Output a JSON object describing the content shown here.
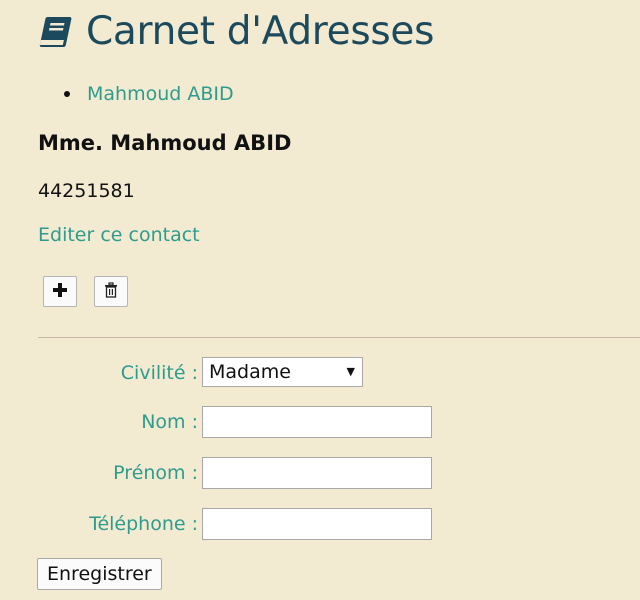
{
  "header": {
    "title": "Carnet d'Adresses",
    "icon": "book-icon"
  },
  "contacts": [
    {
      "label": "Mahmoud ABID"
    }
  ],
  "selected_contact": {
    "full_name": "Mme. Mahmoud ABID",
    "phone": "44251581",
    "edit_link": "Editer ce contact"
  },
  "actions": {
    "add_icon": "plus-icon",
    "delete_icon": "trash-icon"
  },
  "form": {
    "civilite": {
      "label": "Civilité :",
      "value": "Madame"
    },
    "nom": {
      "label": "Nom :",
      "value": ""
    },
    "prenom": {
      "label": "Prénom :",
      "value": ""
    },
    "telephone": {
      "label": "Téléphone :",
      "value": ""
    },
    "submit_label": "Enregistrer"
  },
  "colors": {
    "background": "#f3ead2",
    "title": "#1c4a5c",
    "link": "#2e9c8c",
    "divider": "#c9b7a9"
  }
}
